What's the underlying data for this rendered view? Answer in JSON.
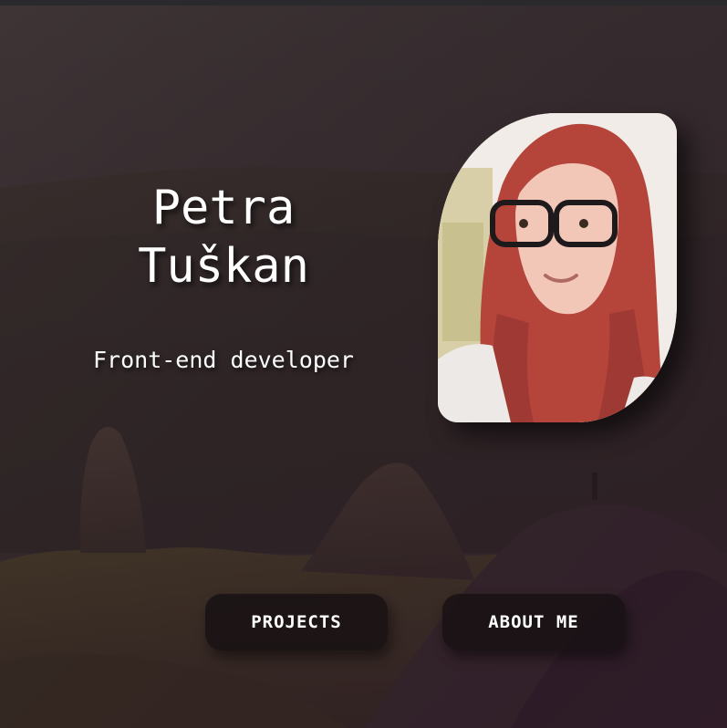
{
  "hero": {
    "name_first": "Petra",
    "name_last": "Tuškan",
    "subtitle": "Front-end developer"
  },
  "portrait": {
    "alt": "Portrait photo of Petra Tuškan"
  },
  "nav": {
    "projects_label": "PROJECTS",
    "about_label": "ABOUT ME"
  },
  "colors": {
    "text": "#ffffff",
    "button_bg": "#161012",
    "background_tint": "#3b3133",
    "hair": "#b5443a"
  }
}
